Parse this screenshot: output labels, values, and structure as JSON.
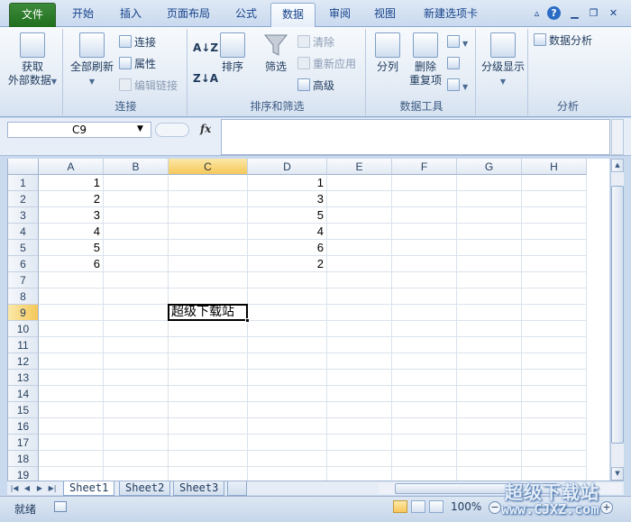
{
  "tabs": [
    "文件",
    "开始",
    "插入",
    "页面布局",
    "公式",
    "数据",
    "审阅",
    "视图",
    "新建选项卡"
  ],
  "active_tab": "数据",
  "ribbon": {
    "get_data": {
      "line1": "获取",
      "line2": "外部数据"
    },
    "refresh_all": "全部刷新",
    "connections": "连接",
    "properties": "属性",
    "edit_links": "编辑链接",
    "group_connections": "连接",
    "sort": "排序",
    "filter": "筛选",
    "clear": "清除",
    "reapply": "重新应用",
    "advanced": "高级",
    "group_sort_filter": "排序和筛选",
    "split": "分列",
    "remove_dup": {
      "line1": "删除",
      "line2": "重复项"
    },
    "group_data_tools": "数据工具",
    "outline": "分级显示",
    "data_analysis": "数据分析",
    "group_analysis": "分析"
  },
  "formula_bar": {
    "name_box": "C9",
    "fx": "fx",
    "content": ""
  },
  "columns": [
    "A",
    "B",
    "C",
    "D",
    "E",
    "F",
    "G",
    "H"
  ],
  "selected_column": "C",
  "rows": [
    "1",
    "2",
    "3",
    "4",
    "5",
    "6",
    "7",
    "8",
    "9",
    "10",
    "11",
    "12",
    "13",
    "14",
    "15",
    "16",
    "17",
    "18",
    "19"
  ],
  "selected_row": "9",
  "cells": {
    "A": [
      "1",
      "2",
      "3",
      "4",
      "5",
      "6"
    ],
    "D": [
      "1",
      "3",
      "5",
      "4",
      "6",
      "2"
    ],
    "C9": "超级下载站"
  },
  "sheets": [
    "Sheet1",
    "Sheet2",
    "Sheet3"
  ],
  "active_sheet": "Sheet1",
  "status": {
    "ready": "就绪",
    "zoom": "100%"
  },
  "watermark": {
    "line1": "超级下载站",
    "line2": "www.CJXZ.com"
  }
}
